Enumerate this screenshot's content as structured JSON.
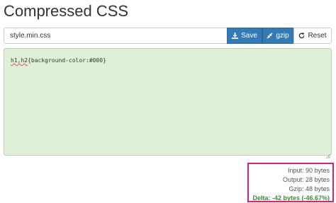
{
  "page": {
    "title": "Compressed CSS"
  },
  "toolbar": {
    "filename_value": "style.min.css",
    "save_label": "Save",
    "gzip_label": "gzip",
    "reset_label": "Reset"
  },
  "editor": {
    "code_selector": "h1,h2",
    "code_rest": "{background-color:#000}"
  },
  "stats": {
    "input": "Input: 90 bytes",
    "output": "Output: 28 bytes",
    "gzip": "Gzip: 48 bytes",
    "delta": "Delta: -42 bytes (-46.67%)"
  },
  "colors": {
    "primary": "#337ab7",
    "editor_bg": "#dff0d8",
    "highlight_border": "#e0206e",
    "delta_text": "#3c8a3c"
  },
  "icons": {
    "save": "download-icon",
    "gzip": "compress-icon",
    "reset": "refresh-icon"
  }
}
